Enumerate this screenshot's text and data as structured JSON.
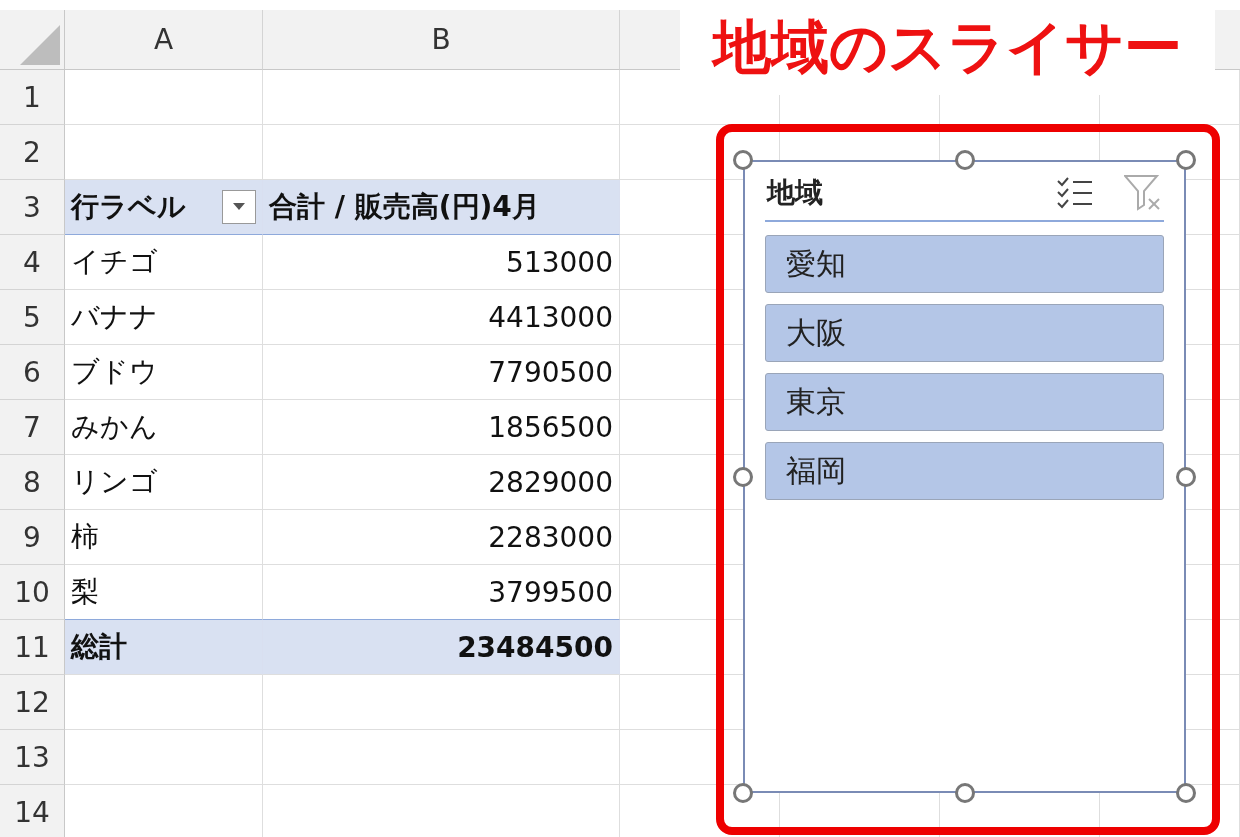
{
  "column_headers": [
    "A",
    "B"
  ],
  "row_numbers": [
    "1",
    "2",
    "3",
    "4",
    "5",
    "6",
    "7",
    "8",
    "9",
    "10",
    "11",
    "12",
    "13",
    "14"
  ],
  "pivot": {
    "row_label": "行ラベル",
    "value_label": "合計 / 販売高(円)4月",
    "rows": [
      {
        "label": "イチゴ",
        "value": "513000"
      },
      {
        "label": "バナナ",
        "value": "4413000"
      },
      {
        "label": "ブドウ",
        "value": "7790500"
      },
      {
        "label": "みかん",
        "value": "1856500"
      },
      {
        "label": "リンゴ",
        "value": "2829000"
      },
      {
        "label": "柿",
        "value": "2283000"
      },
      {
        "label": "梨",
        "value": "3799500"
      }
    ],
    "total": {
      "label": "総計",
      "value": "23484500"
    }
  },
  "callout": {
    "title": "地域のスライサー"
  },
  "slicer": {
    "title": "地域",
    "items": [
      {
        "label": "愛知",
        "selected": true
      },
      {
        "label": "大阪",
        "selected": true
      },
      {
        "label": "東京",
        "selected": true
      },
      {
        "label": "福岡",
        "selected": true
      }
    ]
  }
}
